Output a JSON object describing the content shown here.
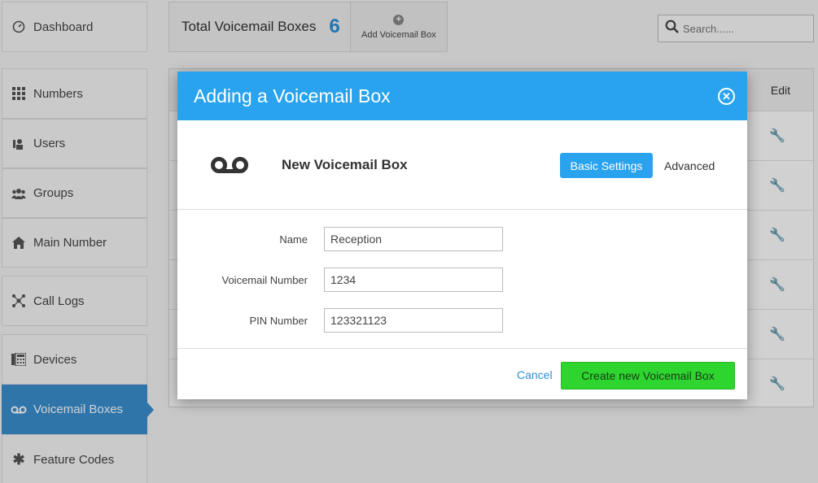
{
  "sidebar": {
    "items": [
      {
        "label": "Dashboard",
        "icon": "speedometer-icon"
      },
      {
        "label": "Numbers",
        "icon": "grid-icon"
      },
      {
        "label": "Users",
        "icon": "user-icon"
      },
      {
        "label": "Groups",
        "icon": "group-icon"
      },
      {
        "label": "Main Number",
        "icon": "home-icon"
      },
      {
        "label": "Call Logs",
        "icon": "network-icon"
      },
      {
        "label": "Devices",
        "icon": "phone-icon"
      },
      {
        "label": "Voicemail Boxes",
        "icon": "voicemail-icon",
        "active": true
      },
      {
        "label": "Feature Codes",
        "icon": "asterisk-icon"
      }
    ]
  },
  "header": {
    "total_label": "Total Voicemail Boxes",
    "total_count": "6",
    "add_button_label": "Add Voicemail Box"
  },
  "search": {
    "placeholder": "Search......"
  },
  "table": {
    "edit_header": "Edit",
    "row_count": 6
  },
  "modal": {
    "title": "Adding a Voicemail Box",
    "subtitle": "New Voicemail Box",
    "tabs": {
      "basic": "Basic Settings",
      "advanced": "Advanced"
    },
    "fields": {
      "name_label": "Name",
      "name_value": "Reception",
      "vm_number_label": "Voicemail Number",
      "vm_number_value": "1234",
      "pin_label": "PIN Number",
      "pin_value": "123321123"
    },
    "cancel_label": "Cancel",
    "create_label": "Create new Voicemail Box"
  },
  "colors": {
    "accent": "#29a3ee",
    "sidebar_active": "#3a8fd0",
    "create_button": "#2ed52e"
  }
}
